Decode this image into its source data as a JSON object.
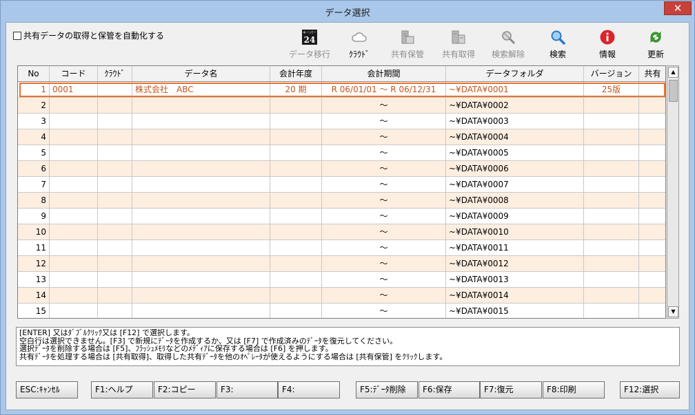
{
  "window": {
    "title": "データ選択",
    "close": "✕"
  },
  "auto_checkbox": {
    "label": "共有データの取得と保管を自動化する",
    "checked": false
  },
  "toolbar": [
    {
      "id": "migrate",
      "label": "データ移行",
      "icon": "keeper24-logo-icon",
      "badge_top": "キーパー",
      "badge_num": "24",
      "enabled": false
    },
    {
      "id": "cloud",
      "label": "ｸﾗｳﾄﾞ",
      "icon": "cloud-icon",
      "enabled": true
    },
    {
      "id": "share-store",
      "label": "共有保管",
      "icon": "share-store-icon",
      "enabled": false
    },
    {
      "id": "share-get",
      "label": "共有取得",
      "icon": "share-get-icon",
      "enabled": false
    },
    {
      "id": "search-clear",
      "label": "検索解除",
      "icon": "search-clear-icon",
      "enabled": false
    },
    {
      "id": "search",
      "label": "検索",
      "icon": "search-icon",
      "enabled": true
    },
    {
      "id": "info",
      "label": "情報",
      "icon": "info-icon",
      "enabled": true
    },
    {
      "id": "refresh",
      "label": "更新",
      "icon": "refresh-icon",
      "enabled": true
    }
  ],
  "columns": [
    "No",
    "コード",
    "ｸﾗｳﾄﾞ",
    "データ名",
    "会計年度",
    "会計期間",
    "データフォルダ",
    "バージョン",
    "共有"
  ],
  "rows": [
    {
      "no": "1",
      "code": "0001",
      "cloud": "",
      "name": "株式会社　ABC",
      "year": "20 期",
      "period": "R 06/01/01 〜 R 06/12/31",
      "folder": "~¥DATA¥0001",
      "version": "25版",
      "shared": ""
    },
    {
      "no": "2",
      "code": "",
      "cloud": "",
      "name": "",
      "year": "",
      "period": "〜",
      "folder": "~¥DATA¥0002",
      "version": "",
      "shared": ""
    },
    {
      "no": "3",
      "code": "",
      "cloud": "",
      "name": "",
      "year": "",
      "period": "〜",
      "folder": "~¥DATA¥0003",
      "version": "",
      "shared": ""
    },
    {
      "no": "4",
      "code": "",
      "cloud": "",
      "name": "",
      "year": "",
      "period": "〜",
      "folder": "~¥DATA¥0004",
      "version": "",
      "shared": ""
    },
    {
      "no": "5",
      "code": "",
      "cloud": "",
      "name": "",
      "year": "",
      "period": "〜",
      "folder": "~¥DATA¥0005",
      "version": "",
      "shared": ""
    },
    {
      "no": "6",
      "code": "",
      "cloud": "",
      "name": "",
      "year": "",
      "period": "〜",
      "folder": "~¥DATA¥0006",
      "version": "",
      "shared": ""
    },
    {
      "no": "7",
      "code": "",
      "cloud": "",
      "name": "",
      "year": "",
      "period": "〜",
      "folder": "~¥DATA¥0007",
      "version": "",
      "shared": ""
    },
    {
      "no": "8",
      "code": "",
      "cloud": "",
      "name": "",
      "year": "",
      "period": "〜",
      "folder": "~¥DATA¥0008",
      "version": "",
      "shared": ""
    },
    {
      "no": "9",
      "code": "",
      "cloud": "",
      "name": "",
      "year": "",
      "period": "〜",
      "folder": "~¥DATA¥0009",
      "version": "",
      "shared": ""
    },
    {
      "no": "10",
      "code": "",
      "cloud": "",
      "name": "",
      "year": "",
      "period": "〜",
      "folder": "~¥DATA¥0010",
      "version": "",
      "shared": ""
    },
    {
      "no": "11",
      "code": "",
      "cloud": "",
      "name": "",
      "year": "",
      "period": "〜",
      "folder": "~¥DATA¥0011",
      "version": "",
      "shared": ""
    },
    {
      "no": "12",
      "code": "",
      "cloud": "",
      "name": "",
      "year": "",
      "period": "〜",
      "folder": "~¥DATA¥0012",
      "version": "",
      "shared": ""
    },
    {
      "no": "13",
      "code": "",
      "cloud": "",
      "name": "",
      "year": "",
      "period": "〜",
      "folder": "~¥DATA¥0013",
      "version": "",
      "shared": ""
    },
    {
      "no": "14",
      "code": "",
      "cloud": "",
      "name": "",
      "year": "",
      "period": "〜",
      "folder": "~¥DATA¥0014",
      "version": "",
      "shared": ""
    },
    {
      "no": "15",
      "code": "",
      "cloud": "",
      "name": "",
      "year": "",
      "period": "〜",
      "folder": "~¥DATA¥0015",
      "version": "",
      "shared": ""
    }
  ],
  "selected_row": "1",
  "scroll": {
    "up": "▲",
    "down": "▼"
  },
  "help_lines": [
    "[ENTER] 又はﾀﾞﾌﾞﾙｸﾘｯｸ又は [F12] で選択します。",
    "空白行は選択できません。[F3] で新規にﾃﾞｰﾀを作成するか、又は [F7] で作成済みのﾃﾞｰﾀを復元してください。",
    "選択ﾃﾞｰﾀを削除する場合は [F5]、ﾌﾗｯｼｭﾒﾓﾘなどのﾒﾃﾞｨｱに保存する場合は [F6] を押します。",
    "共有ﾃﾞｰﾀを処理する場合は [共有取得]、取得した共有ﾃﾞｰﾀを他のｵﾍﾟﾚｰﾀが使えるようにする場合は [共有保管] をｸﾘｯｸします。"
  ],
  "fkeys": [
    {
      "id": "esc",
      "label": "ESC:ｷｬﾝｾﾙ"
    },
    {
      "id": "f1",
      "label": "F1:ヘルプ"
    },
    {
      "id": "f2",
      "label": "F2:コピー"
    },
    {
      "id": "f3",
      "label": "F3:"
    },
    {
      "id": "f4",
      "label": "F4:"
    },
    {
      "id": "f5",
      "label": "F5:ﾃﾞｰﾀ削除"
    },
    {
      "id": "f6",
      "label": "F6:保存"
    },
    {
      "id": "f7",
      "label": "F7:復元"
    },
    {
      "id": "f8",
      "label": "F8:印刷"
    },
    {
      "id": "f12",
      "label": "F12:選択"
    }
  ],
  "colors": {
    "selected_text": "#c1551c",
    "selected_border": "#e8722d",
    "alt_row": "#fdeee0",
    "info_red": "#d9262b",
    "search_blue": "#2b78c8",
    "refresh_green": "#3aa628"
  }
}
